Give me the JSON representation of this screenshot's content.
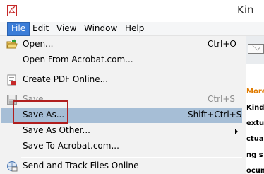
{
  "window": {
    "title": "Kin"
  },
  "menubar": {
    "items": [
      "File",
      "Edit",
      "View",
      "Window",
      "Help"
    ]
  },
  "background_document": {
    "lines": [
      "More",
      "Kindl",
      "extua",
      "ctua",
      "ng s",
      "ng s",
      "ocum"
    ]
  },
  "file_menu": {
    "open": {
      "label": "Open...",
      "shortcut": "Ctrl+O",
      "icon": "open-folder-icon"
    },
    "open_acrobat": {
      "label": "Open From Acrobat.com..."
    },
    "create_pdf": {
      "label": "Create PDF Online...",
      "icon": "create-pdf-icon"
    },
    "save": {
      "label": "Save",
      "shortcut": "Ctrl+S",
      "disabled": true,
      "icon": "floppy-disk-icon"
    },
    "save_as": {
      "label": "Save As...",
      "shortcut": "Shift+Ctrl+S",
      "highlighted": true
    },
    "save_as_other": {
      "label": "Save As Other...",
      "has_submenu": true
    },
    "save_to_acrobat": {
      "label": "Save To Acrobat.com..."
    },
    "send_track": {
      "label": "Send and Track Files Online",
      "icon": "send-track-icon"
    }
  },
  "colors": {
    "menubar_active": "#3b7dd8",
    "highlight": "#a6bed6",
    "focus_outline": "#b01e1e",
    "accent_text": "#e07b00"
  }
}
